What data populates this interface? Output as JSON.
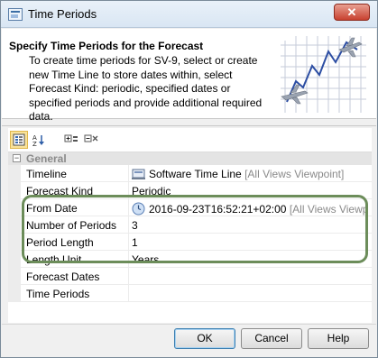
{
  "window": {
    "title": "Time Periods",
    "close_label": "✕"
  },
  "header": {
    "title": "Specify Time Periods for the Forecast",
    "description": "To create time periods for SV-9, select or create new Time Line to store dates within, select Forecast Kind: periodic, specified dates or specified periods and provide additional required data."
  },
  "toolbar": {
    "icons": [
      "categorized-view-icon",
      "sort-alphabetical-icon",
      "expand-all-icon",
      "collapse-all-icon"
    ]
  },
  "properties": {
    "group_label": "General",
    "group_toggle": "−",
    "rows": [
      {
        "name": "Timeline",
        "value": "Software Time Line",
        "suffix": "[All Views Viewpoint]",
        "icon": "timeline-icon"
      },
      {
        "name": "Forecast Kind",
        "value": "Periodic",
        "suffix": ""
      },
      {
        "name": "From Date",
        "value": "2016-09-23T16:52:21+02:00",
        "suffix": "[All Views Viewpoi...",
        "icon": "clock-icon"
      },
      {
        "name": "Number of Periods",
        "value": "3",
        "suffix": ""
      },
      {
        "name": "Period Length",
        "value": "1",
        "suffix": ""
      },
      {
        "name": "Length Unit",
        "value": "Years",
        "suffix": ""
      },
      {
        "name": "Forecast Dates",
        "value": "",
        "suffix": ""
      },
      {
        "name": "Time Periods",
        "value": "",
        "suffix": ""
      }
    ]
  },
  "footer": {
    "ok_label": "OK",
    "cancel_label": "Cancel",
    "help_label": "Help"
  },
  "colors": {
    "highlight_border": "#6c8d5a",
    "title_close": "#c8412f"
  }
}
